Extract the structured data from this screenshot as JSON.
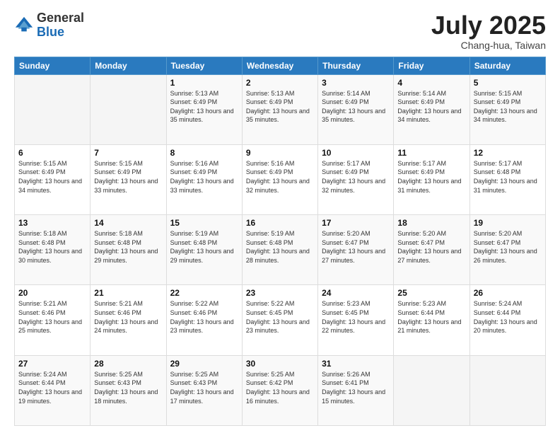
{
  "logo": {
    "general": "General",
    "blue": "Blue"
  },
  "title": {
    "month_year": "July 2025",
    "location": "Chang-hua, Taiwan"
  },
  "days_of_week": [
    "Sunday",
    "Monday",
    "Tuesday",
    "Wednesday",
    "Thursday",
    "Friday",
    "Saturday"
  ],
  "weeks": [
    [
      {
        "day": "",
        "sunrise": "",
        "sunset": "",
        "daylight": ""
      },
      {
        "day": "",
        "sunrise": "",
        "sunset": "",
        "daylight": ""
      },
      {
        "day": "1",
        "sunrise": "Sunrise: 5:13 AM",
        "sunset": "Sunset: 6:49 PM",
        "daylight": "Daylight: 13 hours and 35 minutes."
      },
      {
        "day": "2",
        "sunrise": "Sunrise: 5:13 AM",
        "sunset": "Sunset: 6:49 PM",
        "daylight": "Daylight: 13 hours and 35 minutes."
      },
      {
        "day": "3",
        "sunrise": "Sunrise: 5:14 AM",
        "sunset": "Sunset: 6:49 PM",
        "daylight": "Daylight: 13 hours and 35 minutes."
      },
      {
        "day": "4",
        "sunrise": "Sunrise: 5:14 AM",
        "sunset": "Sunset: 6:49 PM",
        "daylight": "Daylight: 13 hours and 34 minutes."
      },
      {
        "day": "5",
        "sunrise": "Sunrise: 5:15 AM",
        "sunset": "Sunset: 6:49 PM",
        "daylight": "Daylight: 13 hours and 34 minutes."
      }
    ],
    [
      {
        "day": "6",
        "sunrise": "Sunrise: 5:15 AM",
        "sunset": "Sunset: 6:49 PM",
        "daylight": "Daylight: 13 hours and 34 minutes."
      },
      {
        "day": "7",
        "sunrise": "Sunrise: 5:15 AM",
        "sunset": "Sunset: 6:49 PM",
        "daylight": "Daylight: 13 hours and 33 minutes."
      },
      {
        "day": "8",
        "sunrise": "Sunrise: 5:16 AM",
        "sunset": "Sunset: 6:49 PM",
        "daylight": "Daylight: 13 hours and 33 minutes."
      },
      {
        "day": "9",
        "sunrise": "Sunrise: 5:16 AM",
        "sunset": "Sunset: 6:49 PM",
        "daylight": "Daylight: 13 hours and 32 minutes."
      },
      {
        "day": "10",
        "sunrise": "Sunrise: 5:17 AM",
        "sunset": "Sunset: 6:49 PM",
        "daylight": "Daylight: 13 hours and 32 minutes."
      },
      {
        "day": "11",
        "sunrise": "Sunrise: 5:17 AM",
        "sunset": "Sunset: 6:49 PM",
        "daylight": "Daylight: 13 hours and 31 minutes."
      },
      {
        "day": "12",
        "sunrise": "Sunrise: 5:17 AM",
        "sunset": "Sunset: 6:48 PM",
        "daylight": "Daylight: 13 hours and 31 minutes."
      }
    ],
    [
      {
        "day": "13",
        "sunrise": "Sunrise: 5:18 AM",
        "sunset": "Sunset: 6:48 PM",
        "daylight": "Daylight: 13 hours and 30 minutes."
      },
      {
        "day": "14",
        "sunrise": "Sunrise: 5:18 AM",
        "sunset": "Sunset: 6:48 PM",
        "daylight": "Daylight: 13 hours and 29 minutes."
      },
      {
        "day": "15",
        "sunrise": "Sunrise: 5:19 AM",
        "sunset": "Sunset: 6:48 PM",
        "daylight": "Daylight: 13 hours and 29 minutes."
      },
      {
        "day": "16",
        "sunrise": "Sunrise: 5:19 AM",
        "sunset": "Sunset: 6:48 PM",
        "daylight": "Daylight: 13 hours and 28 minutes."
      },
      {
        "day": "17",
        "sunrise": "Sunrise: 5:20 AM",
        "sunset": "Sunset: 6:47 PM",
        "daylight": "Daylight: 13 hours and 27 minutes."
      },
      {
        "day": "18",
        "sunrise": "Sunrise: 5:20 AM",
        "sunset": "Sunset: 6:47 PM",
        "daylight": "Daylight: 13 hours and 27 minutes."
      },
      {
        "day": "19",
        "sunrise": "Sunrise: 5:20 AM",
        "sunset": "Sunset: 6:47 PM",
        "daylight": "Daylight: 13 hours and 26 minutes."
      }
    ],
    [
      {
        "day": "20",
        "sunrise": "Sunrise: 5:21 AM",
        "sunset": "Sunset: 6:46 PM",
        "daylight": "Daylight: 13 hours and 25 minutes."
      },
      {
        "day": "21",
        "sunrise": "Sunrise: 5:21 AM",
        "sunset": "Sunset: 6:46 PM",
        "daylight": "Daylight: 13 hours and 24 minutes."
      },
      {
        "day": "22",
        "sunrise": "Sunrise: 5:22 AM",
        "sunset": "Sunset: 6:46 PM",
        "daylight": "Daylight: 13 hours and 23 minutes."
      },
      {
        "day": "23",
        "sunrise": "Sunrise: 5:22 AM",
        "sunset": "Sunset: 6:45 PM",
        "daylight": "Daylight: 13 hours and 23 minutes."
      },
      {
        "day": "24",
        "sunrise": "Sunrise: 5:23 AM",
        "sunset": "Sunset: 6:45 PM",
        "daylight": "Daylight: 13 hours and 22 minutes."
      },
      {
        "day": "25",
        "sunrise": "Sunrise: 5:23 AM",
        "sunset": "Sunset: 6:44 PM",
        "daylight": "Daylight: 13 hours and 21 minutes."
      },
      {
        "day": "26",
        "sunrise": "Sunrise: 5:24 AM",
        "sunset": "Sunset: 6:44 PM",
        "daylight": "Daylight: 13 hours and 20 minutes."
      }
    ],
    [
      {
        "day": "27",
        "sunrise": "Sunrise: 5:24 AM",
        "sunset": "Sunset: 6:44 PM",
        "daylight": "Daylight: 13 hours and 19 minutes."
      },
      {
        "day": "28",
        "sunrise": "Sunrise: 5:25 AM",
        "sunset": "Sunset: 6:43 PM",
        "daylight": "Daylight: 13 hours and 18 minutes."
      },
      {
        "day": "29",
        "sunrise": "Sunrise: 5:25 AM",
        "sunset": "Sunset: 6:43 PM",
        "daylight": "Daylight: 13 hours and 17 minutes."
      },
      {
        "day": "30",
        "sunrise": "Sunrise: 5:25 AM",
        "sunset": "Sunset: 6:42 PM",
        "daylight": "Daylight: 13 hours and 16 minutes."
      },
      {
        "day": "31",
        "sunrise": "Sunrise: 5:26 AM",
        "sunset": "Sunset: 6:41 PM",
        "daylight": "Daylight: 13 hours and 15 minutes."
      },
      {
        "day": "",
        "sunrise": "",
        "sunset": "",
        "daylight": ""
      },
      {
        "day": "",
        "sunrise": "",
        "sunset": "",
        "daylight": ""
      }
    ]
  ]
}
